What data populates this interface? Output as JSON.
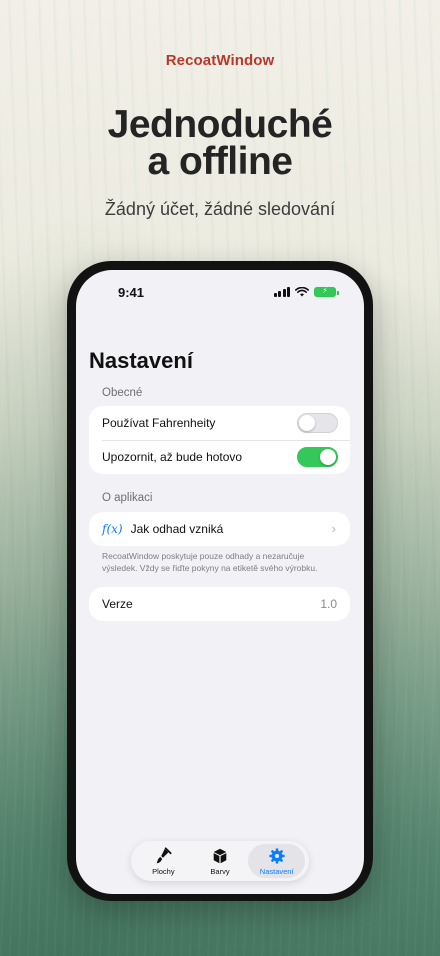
{
  "brand": "RecoatWindow",
  "headline": {
    "line1": "Jednoduché",
    "line2": "a offline"
  },
  "subline": "Žádný účet, žádné sledování",
  "status_bar": {
    "time": "9:41"
  },
  "settings": {
    "title": "Nastavení",
    "general": {
      "header": "Obecné",
      "rows": [
        {
          "label": "Používat Fahrenheity",
          "toggle_on": false
        },
        {
          "label": "Upozornit, až bude hotovo",
          "toggle_on": true
        }
      ]
    },
    "about": {
      "header": "O aplikaci",
      "formula_icon": "f(x)",
      "estimate_label": "Jak odhad vzniká",
      "note": "RecoatWindow poskytuje pouze odhady a nezaručuje výsledek. Vždy se řiďte pokyny na etiketě svého výrobku."
    },
    "version": {
      "label": "Verze",
      "value": "1.0"
    }
  },
  "tabbar": {
    "tabs": [
      {
        "label": "Plochy",
        "icon": "brush-icon",
        "active": false
      },
      {
        "label": "Barvy",
        "icon": "cube-icon",
        "active": false
      },
      {
        "label": "Nastavení",
        "icon": "gear-icon",
        "active": true
      }
    ]
  },
  "colors": {
    "brand": "#b8392c",
    "accent": "#0a7ef8",
    "toggle_on": "#34c759"
  }
}
